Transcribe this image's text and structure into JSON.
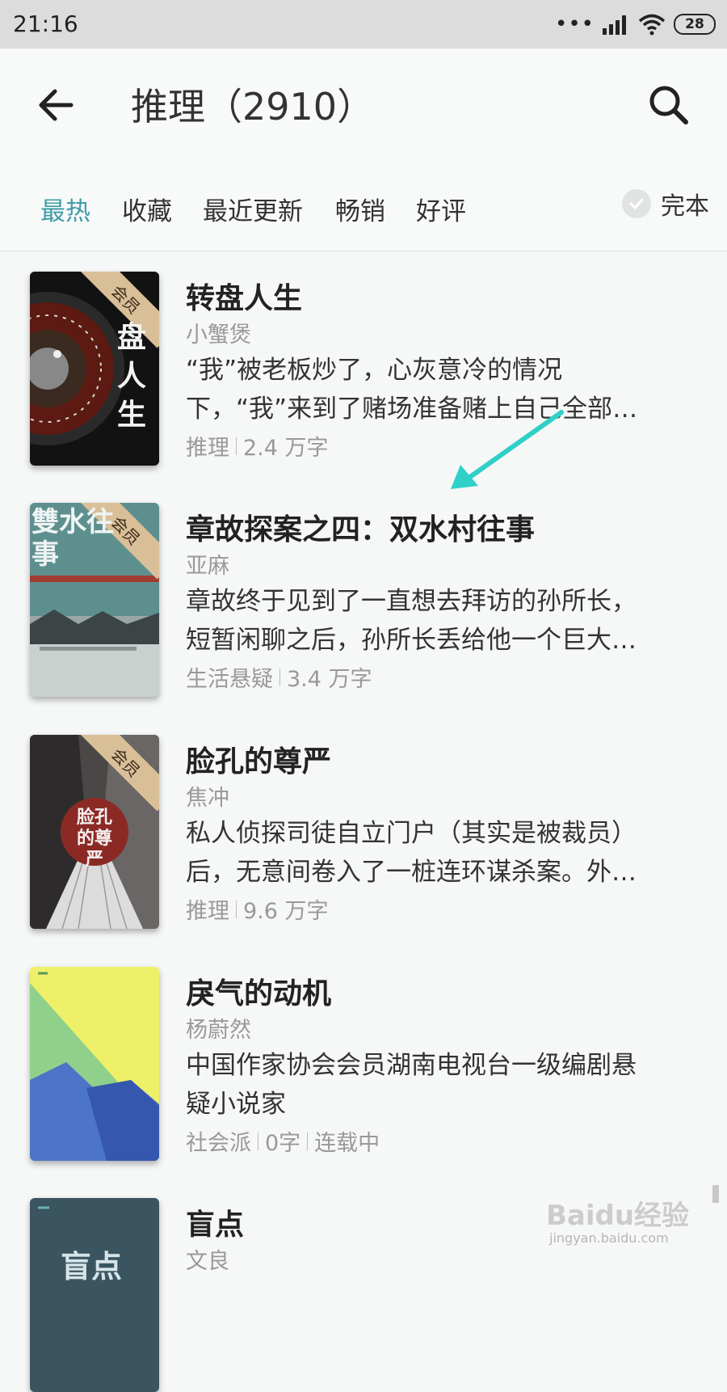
{
  "status_bar": {
    "time": "21:16",
    "signal_dots": "•••",
    "battery": "28"
  },
  "header": {
    "title": "推理（2910）"
  },
  "filters": {
    "tabs": [
      {
        "label": "最热"
      },
      {
        "label": "收藏"
      },
      {
        "label": "最近更新"
      },
      {
        "label": "畅销"
      },
      {
        "label": "好评"
      }
    ],
    "complete_label": "完本"
  },
  "books": [
    {
      "title": "转盘人生",
      "author": "小蟹煲",
      "desc_line1": "“我”被老板炒了，心灰意冷的情况",
      "desc_line2": "下，“我”来到了赌场准备赌上自己全部…",
      "category": "推理",
      "words": "2.4 万字",
      "vip": "会员",
      "cover_text": "盘人生"
    },
    {
      "title": "章故探案之四：双水村往事",
      "author": "亚麻",
      "desc_line1": "章故终于见到了一直想去拜访的孙所长，",
      "desc_line2": "短暂闲聊之后，孙所长丢给他一个巨大…",
      "category": "生活悬疑",
      "words": "3.4 万字",
      "vip": "会员",
      "cover_text": "雙水往事"
    },
    {
      "title": "脸孔的尊严",
      "author": "焦冲",
      "desc_line1": "私人侦探司徒自立门户（其实是被裁员）",
      "desc_line2": "后，无意间卷入了一桩连环谋杀案。外…",
      "category": "推理",
      "words": "9.6 万字",
      "vip": "会员",
      "cover_text": "脸孔的尊严"
    },
    {
      "title": "戾气的动机",
      "author": "杨蔚然",
      "desc_line1": "中国作家协会会员湖南电视台一级编剧悬",
      "desc_line2": "疑小说家",
      "category": "社会派",
      "words": "0字",
      "status": "连载中"
    },
    {
      "title": "盲点",
      "author": "文良",
      "cover_text": "盲点"
    }
  ],
  "watermark": {
    "logo": "Baidu经验",
    "url": "jingyan.baidu.com"
  },
  "colors": {
    "accent": "#3e9da6",
    "annotation_arrow": "#2fd0c8"
  }
}
